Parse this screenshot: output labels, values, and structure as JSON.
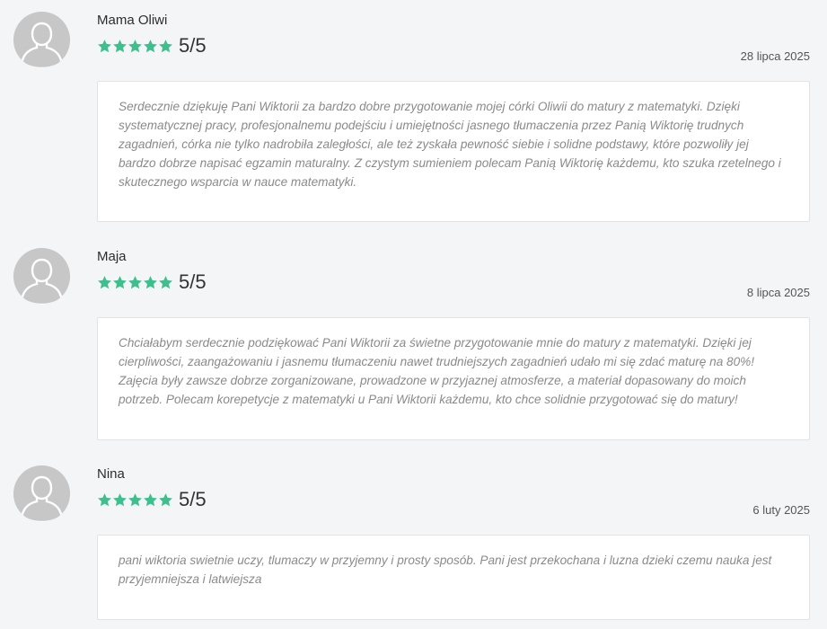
{
  "reviews": [
    {
      "author": "Mama Oliwi",
      "score": "5/5",
      "stars": 5,
      "date": "28 lipca 2025",
      "text": "Serdecznie dziękuję Pani Wiktorii za bardzo dobre przygotowanie mojej córki Oliwii do matury z matematyki. Dzięki systematycznej pracy, profesjonalnemu podejściu i umiejętności jasnego tłumaczenia przez Panią Wiktorię trudnych zagadnień, córka nie tylko nadrobiła zaległości, ale też zyskała pewność siebie i solidne podstawy, które pozwoliły jej bardzo dobrze napisać egzamin maturalny. Z czystym sumieniem polecam Panią Wiktorię każdemu, kto szuka rzetelnego i skutecznego wsparcia w nauce matematyki."
    },
    {
      "author": "Maja",
      "score": "5/5",
      "stars": 5,
      "date": "8 lipca 2025",
      "text": "Chciałabym serdecznie podziękować Pani Wiktorii za świetne przygotowanie mnie do matury z matematyki. Dzięki jej cierpliwości, zaangażowaniu i jasnemu tłumaczeniu nawet trudniejszych zagadnień udało mi się zdać maturę na 80%! Zajęcia były zawsze dobrze zorganizowane, prowadzone w przyjaznej atmosferze, a materiał dopasowany do moich potrzeb. Polecam korepetycje z matematyki u Pani Wiktorii każdemu, kto chce solidnie przygotować się do matury!"
    },
    {
      "author": "Nina",
      "score": "5/5",
      "stars": 5,
      "date": "6 luty 2025",
      "text": "pani wiktoria swietnie uczy, tlumaczy w przyjemny i prosty sposób. Pani jest przekochana i luzna dzieki czemu nauka jest przyjemniejsza i latwiejsza"
    }
  ],
  "colors": {
    "star": "#3fbf8e",
    "avatar_bg": "#c7c7c7",
    "avatar_fg": "#ffffff",
    "page_bg": "#f4f5f7",
    "card_bg": "#ffffff",
    "review_text": "#8a8a8a"
  },
  "icons": {
    "avatar": "user-silhouette-icon",
    "star": "star-filled-icon"
  }
}
